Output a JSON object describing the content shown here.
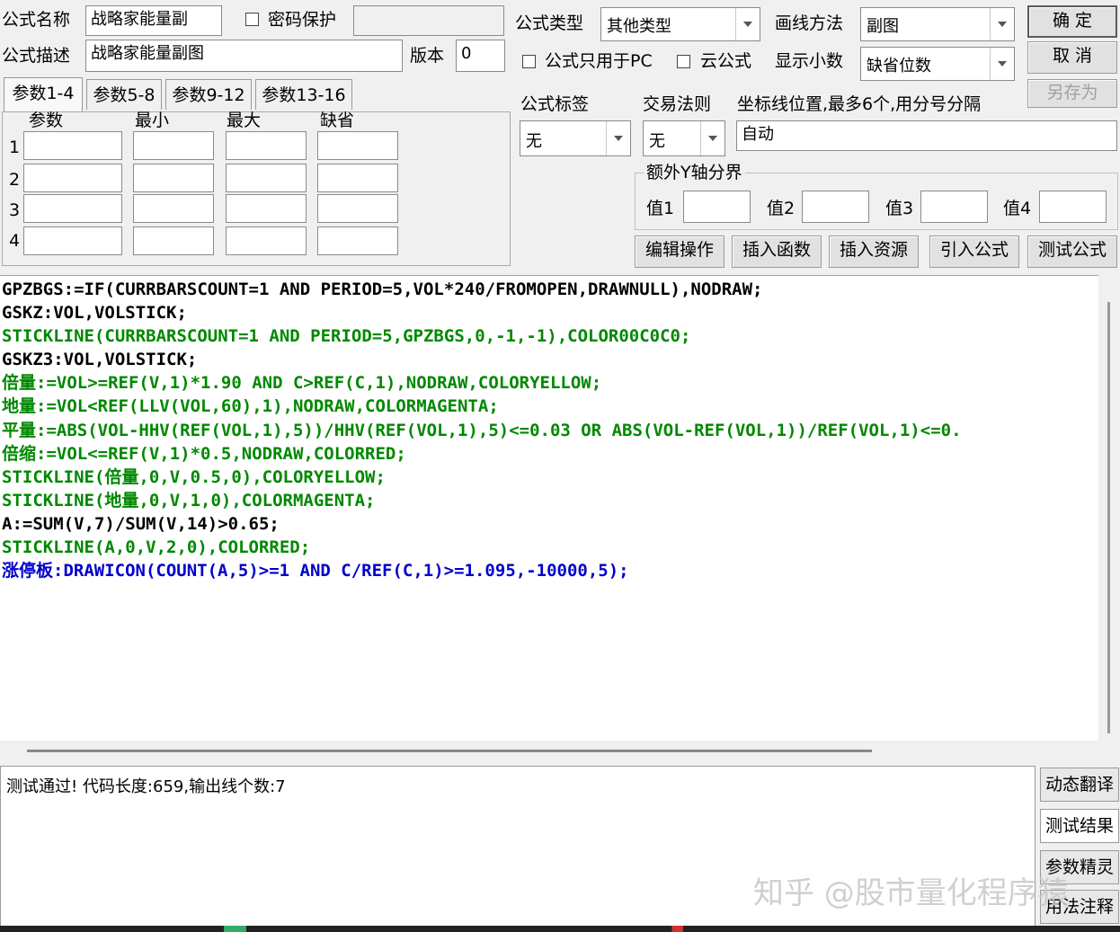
{
  "form": {
    "name_label": "公式名称",
    "name_value": "战略家能量副",
    "password_label": "密码保护",
    "password_value": "",
    "desc_label": "公式描述",
    "desc_value": "战略家能量副图",
    "version_label": "版本",
    "version_value": "0",
    "type_label": "公式类型",
    "type_value": "其他类型",
    "draw_label": "画线方法",
    "draw_value": "副图",
    "pc_only_label": "公式只用于PC",
    "cloud_label": "云公式",
    "decimal_label": "显示小数",
    "decimal_value": "缺省位数",
    "tag_label": "公式标签",
    "tag_value": "无",
    "trade_label": "交易法则",
    "trade_value": "无",
    "coord_label": "坐标线位置,最多6个,用分号分隔",
    "coord_value": "自动",
    "ybound_label": "额外Y轴分界",
    "y1_label": "值1",
    "y2_label": "值2",
    "y3_label": "值3",
    "y4_label": "值4"
  },
  "buttons": {
    "ok": "确  定",
    "cancel": "取  消",
    "save_as": "另存为",
    "edit_ops": "编辑操作",
    "insert_func": "插入函数",
    "insert_res": "插入资源",
    "import_formula": "引入公式",
    "test_formula": "测试公式"
  },
  "tabs": [
    "参数1-4",
    "参数5-8",
    "参数9-12",
    "参数13-16"
  ],
  "params": {
    "headers": [
      "参数",
      "最小",
      "最大",
      "缺省"
    ],
    "rows": [
      "1",
      "2",
      "3",
      "4"
    ]
  },
  "code_lines_plain": [
    "GPZBGS:=IF(CURRBARSCOUNT=1 AND PERIOD=5,VOL*240/FROMOPEN,DRAWNULL),NODRAW;",
    "GSKZ:VOL,VOLSTICK;",
    "STICKLINE(CURRBARSCOUNT=1 AND PERIOD=5,GPZBGS,0,-1,-1),COLOR00C0C0;",
    "GSKZ3:VOL,VOLSTICK;",
    "倍量:=VOL>=REF(V,1)*1.90 AND C>REF(C,1),NODRAW,COLORYELLOW;",
    "地量:=VOL<REF(LLV(VOL,60),1),NODRAW,COLORMAGENTA;",
    "平量:=ABS(VOL-HHV(REF(VOL,1),5))/HHV(REF(VOL,1),5)<=0.03 OR ABS(VOL-REF(VOL,1))/REF(VOL,1)<=0.",
    "倍缩:=VOL<=REF(V,1)*0.5,NODRAW,COLORRED;",
    "STICKLINE(倍量,0,V,0.5,0),COLORYELLOW;",
    "STICKLINE(地量,0,V,1,0),COLORMAGENTA;",
    "A:=SUM(V,7)/SUM(V,14)>0.65;",
    "STICKLINE(A,0,V,2,0),COLORRED;",
    "涨停板:DRAWICON(COUNT(A,5)>=1 AND C/REF(C,1)>=1.095,-10000,5);"
  ],
  "output": {
    "message": "测试通过! 代码长度:659,输出线个数:7"
  },
  "side_tabs": [
    "动态翻译",
    "测试结果",
    "参数精灵",
    "用法注释"
  ],
  "watermark": "知乎 @股市量化程序猿"
}
